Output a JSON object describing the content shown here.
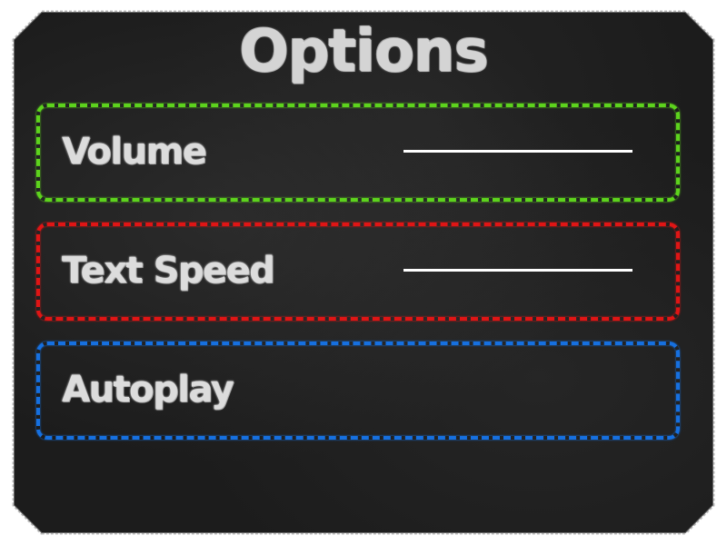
{
  "menu": {
    "title": "Options",
    "options": [
      {
        "label": "Volume",
        "control": "slider",
        "accent": "#5dd31d"
      },
      {
        "label": "Text Speed",
        "control": "slider",
        "accent": "#e01515"
      },
      {
        "label": "Autoplay",
        "control": "none",
        "accent": "#1670e0"
      }
    ]
  },
  "theme": {
    "board_color": "#1c1c1c",
    "chalk_color": "#dcdcdc"
  }
}
